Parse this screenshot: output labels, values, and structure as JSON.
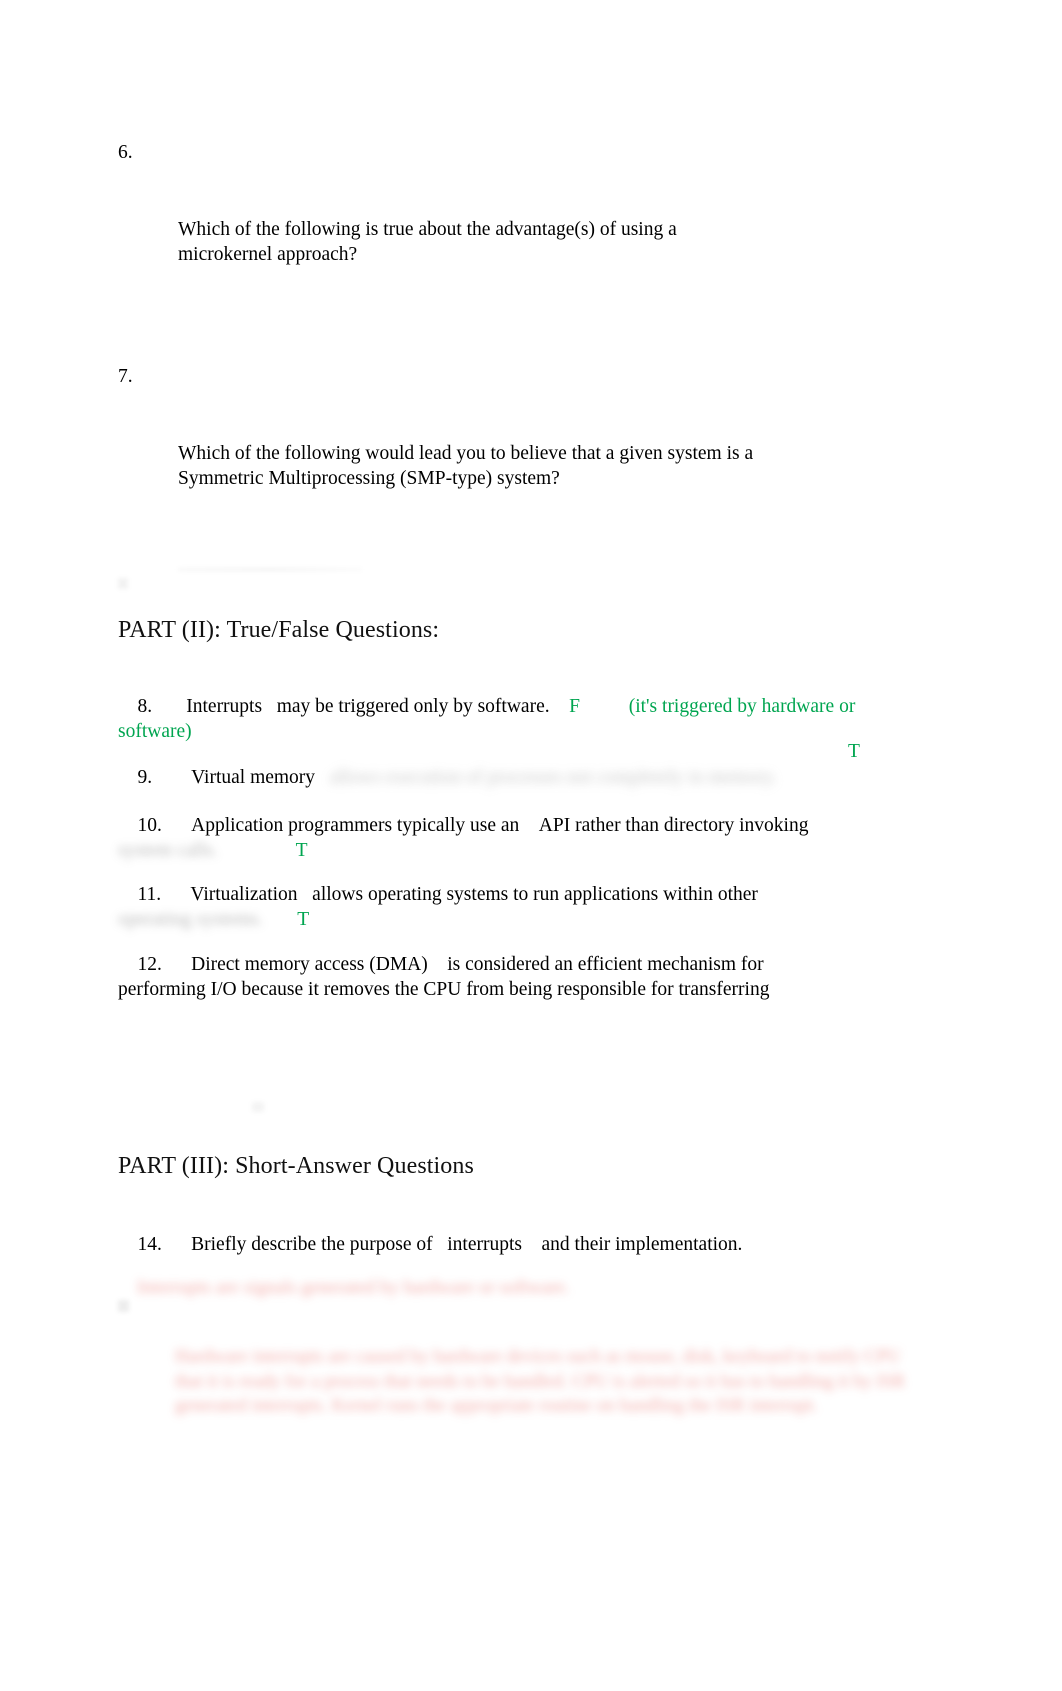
{
  "document": {
    "type": "exam-answer-sheet",
    "colors": {
      "answer_green": "#00a550",
      "answer_red": "#e8655f",
      "body_text": "#000000"
    }
  },
  "questions": {
    "q6": {
      "number": "6.",
      "text": "Which of the following is true about the advantage(s) of using a\nmicrokernel approach?"
    },
    "q7": {
      "number": "7.",
      "text": "Which of the following would lead you to believe that a given system is a\nSymmetric Multiprocessing (SMP-type) system?"
    }
  },
  "part2": {
    "heading": "PART (II): True/False Questions:",
    "items": [
      {
        "number": "8.",
        "term": "Interrupts",
        "statement": "may be triggered only by software.",
        "answer": "F",
        "note": "(it's triggered by hardware or software)"
      },
      {
        "number": "9.",
        "term": "Virtual memory",
        "redacted_statement": "allows execution of processes not completely in memory.",
        "answer": "T"
      },
      {
        "number": "10.",
        "term": "Application programmers typically use an",
        "statement": "API rather than directory invoking",
        "redacted_continuation": "system calls.",
        "answer": "T"
      },
      {
        "number": "11.",
        "term": "Virtualization",
        "statement": "allows operating systems to run applications within other",
        "redacted_continuation": "operating systems.",
        "answer": "T"
      },
      {
        "number": "12.",
        "term": "Direct memory access (DMA)",
        "statement": "is considered an efficient mechanism for\nperforming I/O because it removes the CPU from being responsible for transferring"
      }
    ]
  },
  "part3": {
    "heading": "PART (III): Short-Answer Questions",
    "items": [
      {
        "number": "14.",
        "prompt_before": "Briefly describe the purpose of",
        "term": "interrupts",
        "prompt_after": "and their implementation."
      }
    ],
    "answer_redacted_line": "Interrupts are signals generated by hardware or software.",
    "answer_redacted_block": "Hardware interrupts are caused by hardware devices such as mouse, disk, keyboard to notify CPU that it is ready for a process that needs to be handled. CPU is alerted so it has to handling it by ISR generated interrupts. Kernel runs the appropriate routine on handling the ISR interrupt."
  }
}
